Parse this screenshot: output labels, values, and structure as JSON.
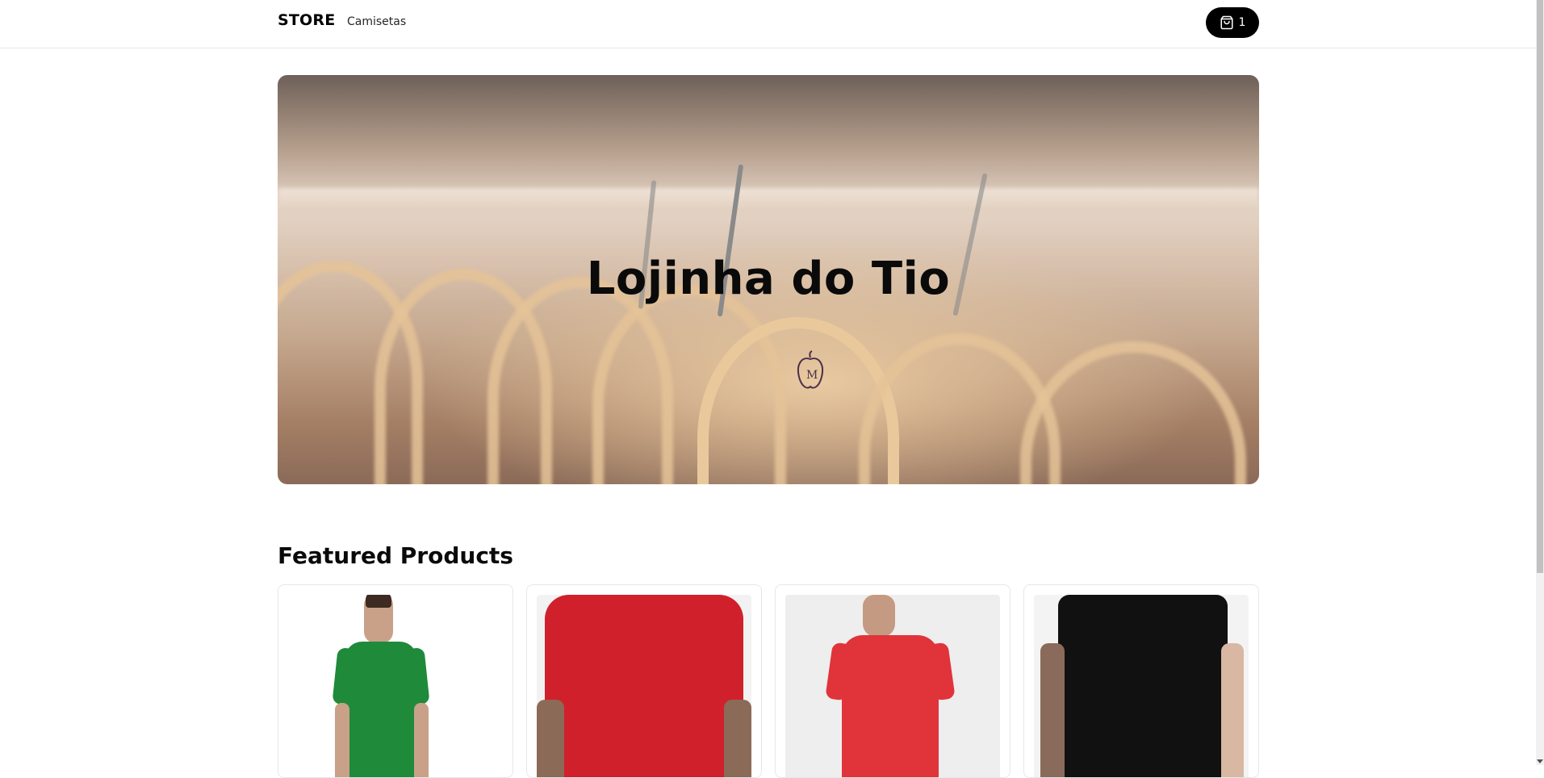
{
  "header": {
    "brand": "STORE",
    "nav_link": "Camisetas",
    "cart_icon": "shopping-bag-icon",
    "cart_count": "1"
  },
  "hero": {
    "title": "Lojinha do Tio",
    "image": "wooden-hangers-photo"
  },
  "featured": {
    "title": "Featured Products",
    "products": [
      {
        "image": "green-tshirt-photo",
        "shirt_color": "#1f8a3a",
        "bg": "#ffffff"
      },
      {
        "image": "red-tshirt-photo",
        "shirt_color": "#d0202c",
        "bg": "#f2f2f2"
      },
      {
        "image": "red-tshirt-back-photo",
        "shirt_color": "#e0343a",
        "bg": "#eeeeee"
      },
      {
        "image": "black-tshirt-photo",
        "shirt_color": "#111111",
        "bg": "#f3f3f3"
      }
    ]
  },
  "colors": {
    "accent": "#000000",
    "border": "#e5e7eb"
  }
}
